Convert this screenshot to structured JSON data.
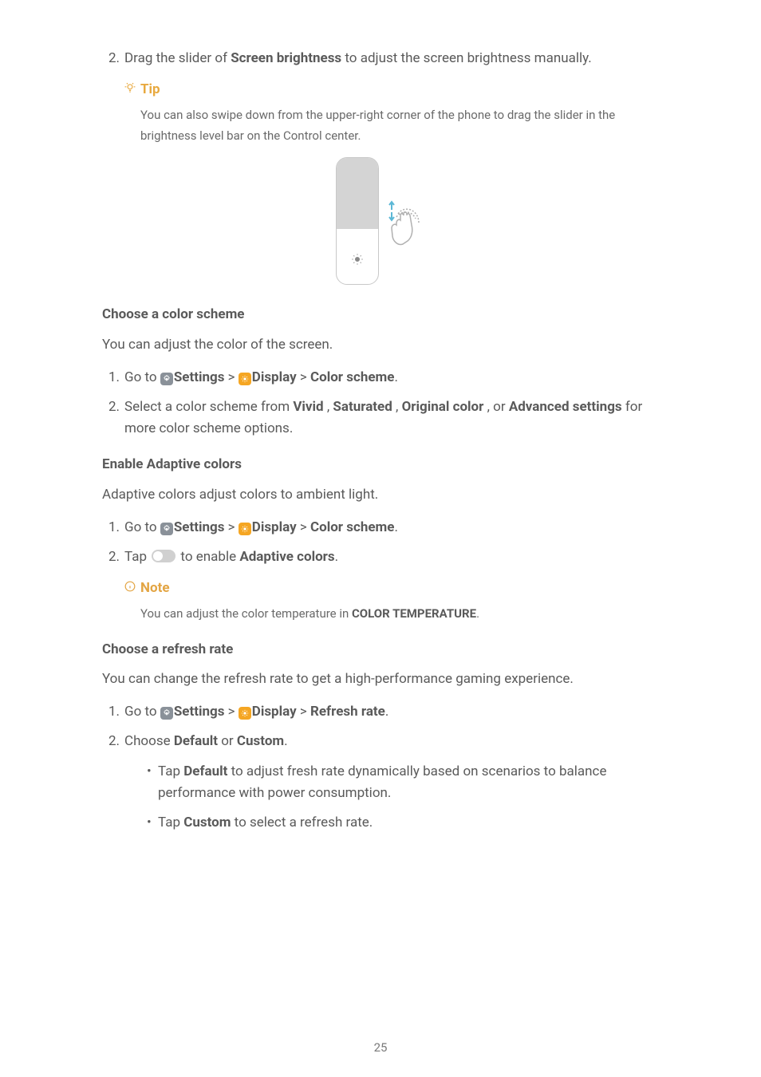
{
  "step2": {
    "num": "2.",
    "pre": "Drag the slider of ",
    "bold": "Screen brightness",
    "post": " to adjust the screen brightness manually."
  },
  "tip": {
    "label": "Tip",
    "body": "You can also swipe down from the upper-right corner of the phone to drag the slider in the brightness level bar on the Control center."
  },
  "section1": {
    "heading": "Choose a color scheme",
    "intro": "You can adjust the color of the screen.",
    "step1": {
      "num": "1.",
      "pre": "Go to ",
      "settings": "Settings",
      "sep1": " > ",
      "display": "Display",
      "sep2": " > ",
      "target": "Color scheme",
      "post": "."
    },
    "step2": {
      "num": "2.",
      "pre": "Select a color scheme from ",
      "opt1": "Vivid",
      "c1": " , ",
      "opt2": "Saturated",
      "c2": " , ",
      "opt3": "Original color",
      "c3": " , or ",
      "opt4": "Advanced settings",
      "post": " for more color scheme options."
    }
  },
  "section2": {
    "heading": "Enable Adaptive colors",
    "intro": "Adaptive colors adjust colors to ambient light.",
    "step1": {
      "num": "1.",
      "pre": "Go to ",
      "settings": "Settings",
      "sep1": " > ",
      "display": "Display",
      "sep2": " > ",
      "target": "Color scheme",
      "post": "."
    },
    "step2": {
      "num": "2.",
      "pre": "Tap ",
      "mid": " to enable ",
      "bold": "Adaptive colors",
      "post": "."
    },
    "note": {
      "label": "Note",
      "pre": "You can adjust the color temperature in ",
      "bold": "COLOR TEMPERATURE",
      "post": "."
    }
  },
  "section3": {
    "heading": "Choose a refresh rate",
    "intro": "You can change the refresh rate to get a high-performance gaming experience.",
    "step1": {
      "num": "1.",
      "pre": "Go to ",
      "settings": "Settings",
      "sep1": " > ",
      "display": "Display",
      "sep2": " > ",
      "target": "Refresh rate",
      "post": "."
    },
    "step2": {
      "num": "2.",
      "pre": "Choose ",
      "opt1": "Default",
      "or": " or ",
      "opt2": "Custom",
      "post": "."
    },
    "bullet1": {
      "pre": "Tap ",
      "bold": "Default",
      "post": " to adjust fresh rate dynamically based on scenarios to balance performance with power consumption."
    },
    "bullet2": {
      "pre": "Tap ",
      "bold": "Custom",
      "post": " to select a refresh rate."
    }
  },
  "page": "25"
}
